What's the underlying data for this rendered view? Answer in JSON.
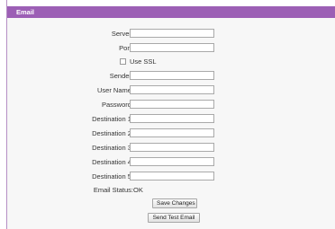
{
  "header": {
    "title": "Email"
  },
  "fields": {
    "server": {
      "label": "Server:",
      "value": ""
    },
    "port": {
      "label": "Port:",
      "value": ""
    },
    "use_ssl": {
      "label": "Use SSL",
      "checked": false
    },
    "sender": {
      "label": "Sender:",
      "value": ""
    },
    "username": {
      "label": "User Name:",
      "value": ""
    },
    "password": {
      "label": "Password:",
      "value": ""
    },
    "dest1": {
      "label": "Destination 1:",
      "value": ""
    },
    "dest2": {
      "label": "Destination 2:",
      "value": ""
    },
    "dest3": {
      "label": "Destination 3:",
      "value": ""
    },
    "dest4": {
      "label": "Destination 4:",
      "value": ""
    },
    "dest5": {
      "label": "Destination 5:",
      "value": ""
    }
  },
  "status": {
    "label": "Email Status:",
    "value": "OK"
  },
  "buttons": {
    "save": "Save Changes",
    "test": "Send Test Email"
  },
  "colors": {
    "header_bg": "#9c5fb5",
    "header_text": "#ffffff",
    "body_bg": "#f7f7f7"
  }
}
